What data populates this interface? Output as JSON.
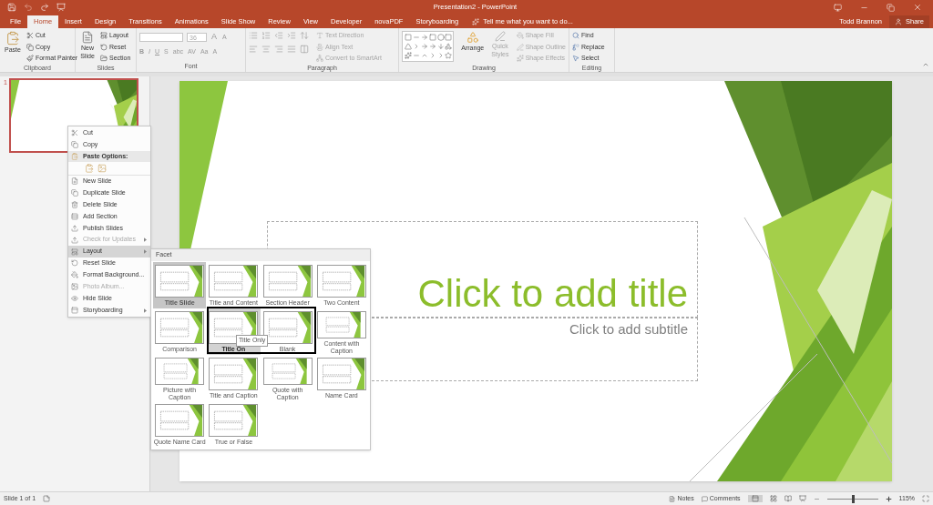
{
  "window": {
    "title": "Presentation2 - PowerPoint"
  },
  "account": {
    "user": "Todd Brannon",
    "share": "Share"
  },
  "tabs": [
    {
      "label": "File",
      "selected": false
    },
    {
      "label": "Home",
      "selected": true
    },
    {
      "label": "Insert",
      "selected": false
    },
    {
      "label": "Design",
      "selected": false
    },
    {
      "label": "Transitions",
      "selected": false
    },
    {
      "label": "Animations",
      "selected": false
    },
    {
      "label": "Slide Show",
      "selected": false
    },
    {
      "label": "Review",
      "selected": false
    },
    {
      "label": "View",
      "selected": false
    },
    {
      "label": "Developer",
      "selected": false
    },
    {
      "label": "novaPDF",
      "selected": false
    },
    {
      "label": "Storyboarding",
      "selected": false
    }
  ],
  "tell_me": {
    "placeholder": "Tell me what you want to do..."
  },
  "ribbon": {
    "clipboard": {
      "label": "Clipboard",
      "paste": "Paste",
      "items": [
        "Cut",
        "Copy",
        "Format Painter"
      ]
    },
    "slides": {
      "label": "Slides",
      "new_slide": "New Slide",
      "items": [
        "Layout",
        "Reset",
        "Section"
      ]
    },
    "font": {
      "label": "Font",
      "font_size": "36",
      "size_buttons": [
        "A",
        "A"
      ],
      "buttons": [
        "B",
        "I",
        "U",
        "S",
        "abc",
        "AV",
        "Aa",
        "A"
      ]
    },
    "paragraph": {
      "label": "Paragraph",
      "commands": [
        {
          "label": "Text Direction",
          "disabled": true
        },
        {
          "label": "Align Text",
          "disabled": true
        },
        {
          "label": "Convert to SmartArt",
          "disabled": true
        }
      ]
    },
    "drawing": {
      "label": "Drawing",
      "arrange": "Arrange",
      "quick_styles": {
        "label": "Quick Styles",
        "disabled": true
      },
      "commands": [
        {
          "label": "Shape Fill",
          "disabled": true
        },
        {
          "label": "Shape Outline",
          "disabled": true
        },
        {
          "label": "Shape Effects",
          "disabled": true
        }
      ]
    },
    "editing": {
      "label": "Editing",
      "items": [
        "Find",
        "Replace",
        "Select"
      ]
    }
  },
  "thumbnails": [
    {
      "number": "1",
      "selected": true
    }
  ],
  "slide": {
    "title_placeholder": "Click to add title",
    "subtitle_placeholder": "Click to add subtitle"
  },
  "context_menu": [
    {
      "kind": "item",
      "label": "Cut",
      "disabled": false,
      "selected": false,
      "submenu": false
    },
    {
      "kind": "item",
      "label": "Copy",
      "disabled": false,
      "selected": false,
      "submenu": false
    },
    {
      "kind": "header",
      "label": "Paste Options:"
    },
    {
      "kind": "paste_options"
    },
    {
      "kind": "item",
      "label": "New Slide",
      "disabled": false,
      "selected": false,
      "submenu": false
    },
    {
      "kind": "item",
      "label": "Duplicate Slide",
      "disabled": false,
      "selected": false,
      "submenu": false
    },
    {
      "kind": "item",
      "label": "Delete Slide",
      "disabled": false,
      "selected": false,
      "submenu": false
    },
    {
      "kind": "item",
      "label": "Add Section",
      "disabled": false,
      "selected": false,
      "submenu": false
    },
    {
      "kind": "item",
      "label": "Publish Slides",
      "disabled": false,
      "selected": false,
      "submenu": false
    },
    {
      "kind": "item",
      "label": "Check for Updates",
      "disabled": true,
      "selected": false,
      "submenu": true
    },
    {
      "kind": "item",
      "label": "Layout",
      "disabled": false,
      "selected": true,
      "submenu": true
    },
    {
      "kind": "item",
      "label": "Reset Slide",
      "disabled": false,
      "selected": false,
      "submenu": false
    },
    {
      "kind": "item",
      "label": "Format Background...",
      "disabled": false,
      "selected": false,
      "submenu": false
    },
    {
      "kind": "item",
      "label": "Photo Album...",
      "disabled": true,
      "selected": false,
      "submenu": false
    },
    {
      "kind": "item",
      "label": "Hide Slide",
      "disabled": false,
      "selected": false,
      "submenu": false
    },
    {
      "kind": "item",
      "label": "Storyboarding",
      "disabled": false,
      "selected": false,
      "submenu": true
    }
  ],
  "layout_gallery": {
    "heading": "Facet",
    "tooltip": "Title Only",
    "layouts": [
      {
        "label": "Title Slide",
        "selected": true,
        "hovered": false
      },
      {
        "label": "Title and Content",
        "selected": false,
        "hovered": false
      },
      {
        "label": "Section Header",
        "selected": false,
        "hovered": false
      },
      {
        "label": "Two Content",
        "selected": false,
        "hovered": false
      },
      {
        "label": "Comparison",
        "selected": false,
        "hovered": false
      },
      {
        "label": "Title On",
        "selected": false,
        "hovered": true
      },
      {
        "label": "Blank",
        "selected": false,
        "hovered": false
      },
      {
        "label": "Content with Caption",
        "selected": false,
        "hovered": false
      },
      {
        "label": "Picture with Caption",
        "selected": false,
        "hovered": false
      },
      {
        "label": "Title and Caption",
        "selected": false,
        "hovered": false
      },
      {
        "label": "Quote with Caption",
        "selected": false,
        "hovered": false
      },
      {
        "label": "Name Card",
        "selected": false,
        "hovered": false
      },
      {
        "label": "Quote Name Card",
        "selected": false,
        "hovered": false
      },
      {
        "label": "True or False",
        "selected": false,
        "hovered": false
      }
    ]
  },
  "status_bar": {
    "slide_count": "Slide 1 of 1",
    "notes": "Notes",
    "comments": "Comments",
    "zoom": {
      "reading": "115%",
      "level": 0.5
    }
  }
}
